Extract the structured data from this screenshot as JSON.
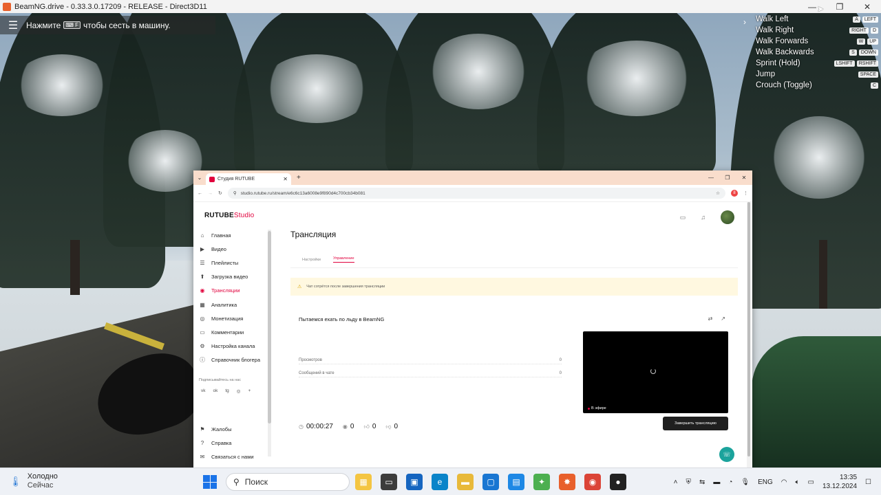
{
  "game_window": {
    "title": "BeamNG.drive - 0.33.3.0.17209 - RELEASE - Direct3D11",
    "controls": [
      "—",
      "❐",
      "✕"
    ]
  },
  "game_hint": {
    "menu_icon": "menu-icon",
    "text_before": "Нажмите",
    "key": "F",
    "text_after": "чтобы сесть в машину."
  },
  "key_bindings": [
    {
      "label": "Walk Left",
      "keys": [
        "A",
        "LEFT"
      ]
    },
    {
      "label": "Walk Right",
      "keys": [
        "RIGHT",
        "D"
      ]
    },
    {
      "label": "Walk Forwards",
      "keys": [
        "W",
        "UP"
      ]
    },
    {
      "label": "Walk Backwards",
      "keys": [
        "S",
        "DOWN"
      ]
    },
    {
      "label": "Sprint (Hold)",
      "keys": [
        "LSHIFT",
        "RSHIFT"
      ]
    },
    {
      "label": "Jump",
      "keys": [
        "SPACE"
      ]
    },
    {
      "label": "Crouch (Toggle)",
      "keys": [
        "C"
      ]
    }
  ],
  "browser": {
    "tab_title": "Студия RUTUBE",
    "url": "studio.rutube.ru/stream/e6c6c13a6008e9f890d4c700cb34b081",
    "ext_badge": "8"
  },
  "studio": {
    "logo_main": "RUTUBE",
    "logo_studio": "Studio",
    "nav": [
      {
        "label": "Главная",
        "icon": "⌂",
        "active": false
      },
      {
        "label": "Видео",
        "icon": "▶",
        "active": false
      },
      {
        "label": "Плейлисты",
        "icon": "☰",
        "active": false
      },
      {
        "label": "Загрузка видео",
        "icon": "⬆",
        "active": false
      },
      {
        "label": "Трансляции",
        "icon": "◉",
        "active": true
      },
      {
        "label": "Аналитика",
        "icon": "▦",
        "active": false
      },
      {
        "label": "Монетизация",
        "icon": "◎",
        "active": false
      },
      {
        "label": "Комментарии",
        "icon": "▭",
        "active": false
      },
      {
        "label": "Настройка канала",
        "icon": "⚙",
        "active": false
      },
      {
        "label": "Справочник блогера",
        "icon": "ⓘ",
        "active": false
      }
    ],
    "subscribe_label": "Подписывайтесь на нас",
    "socials": [
      "vk",
      "ok",
      "tg",
      "◎",
      "+"
    ],
    "nav_bottom": [
      {
        "label": "Жалобы",
        "icon": "⚑"
      },
      {
        "label": "Справка",
        "icon": "?"
      },
      {
        "label": "Связаться с нами",
        "icon": "✉"
      }
    ],
    "page_title": "Трансляция",
    "subtabs": [
      "Настройки",
      "Управление"
    ],
    "active_subtab": "Управление",
    "warning": "Чат сотрётся после завершения трансляции",
    "stream_title": "Пытаемся ехать по льду в BeamNG",
    "stats": [
      {
        "label": "Просмотров",
        "value": "0"
      },
      {
        "label": "Сообщений в чате",
        "value": "0"
      }
    ],
    "live_label": "В эфире",
    "timer": "00:00:27",
    "viewers": "0",
    "likes": "0",
    "dislikes": "0",
    "end_button": "Завершить трансляцию"
  },
  "taskbar": {
    "weather_temp": "Холодно",
    "weather_sub": "Сейчас",
    "search_placeholder": "Поиск",
    "language": "ENG",
    "time": "13:35",
    "date": "13.12.2024"
  }
}
